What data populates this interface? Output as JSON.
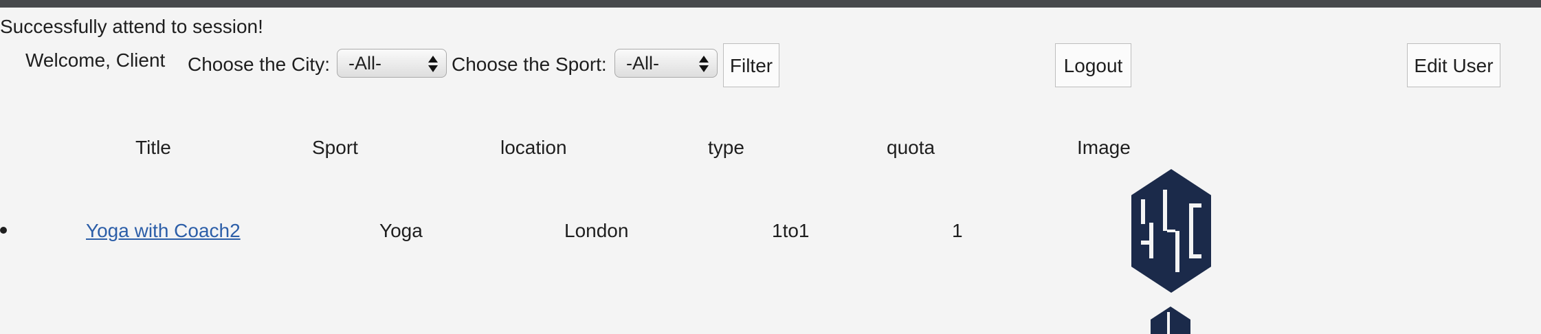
{
  "status_message": "Successfully attend to session!",
  "header": {
    "welcome": "Welcome, Client",
    "city_label": "Choose the City:",
    "city_value": "-All-",
    "sport_label": "Choose the Sport:",
    "sport_value": "-All-",
    "filter_label": "Filter",
    "logout_label": "Logout",
    "edit_user_label": "Edit User"
  },
  "table": {
    "headers": [
      "Title",
      "Sport",
      "location",
      "type",
      "quota",
      "Image"
    ],
    "rows": [
      {
        "title": "Yoga with Coach2",
        "sport": "Yoga",
        "location": "London",
        "type": "1to1",
        "quota": "1",
        "image": "SSC"
      }
    ]
  },
  "colors": {
    "logo": "#1b2a4a",
    "link": "#2c5ea8",
    "topbar": "#47494c"
  }
}
